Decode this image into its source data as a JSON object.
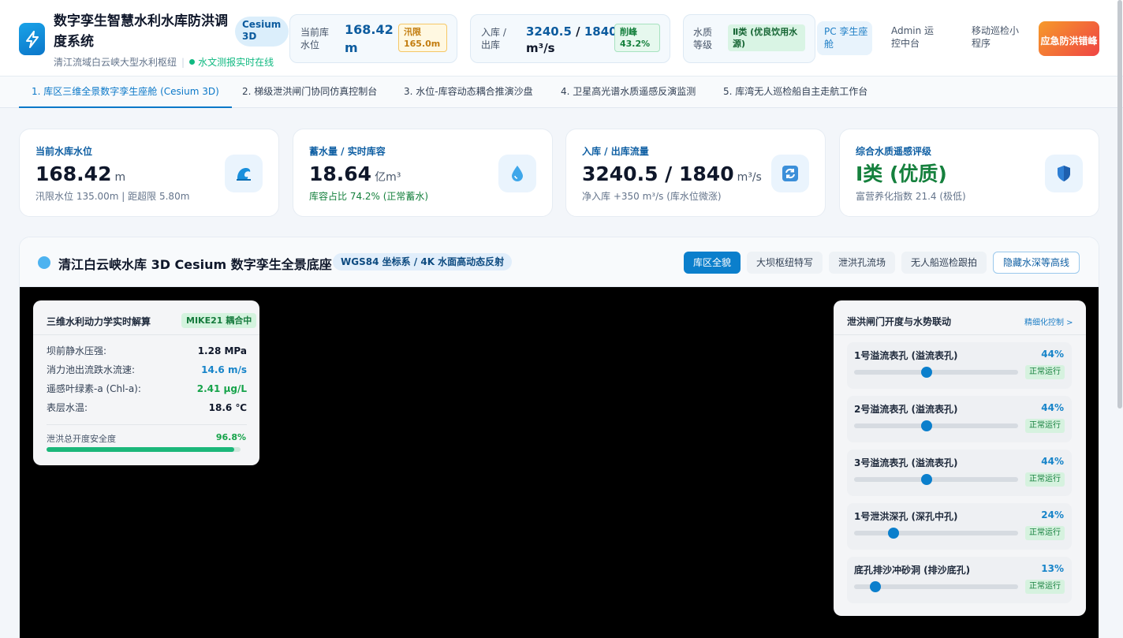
{
  "header": {
    "title": "数字孪生智慧水利水库防洪调度系统",
    "subtitle": "清江流域白云峡大型水利枢纽",
    "sep": "|",
    "live_status": "水文测报实时在线",
    "engine_badge": "Cesium 3D",
    "level": {
      "label": "当前库水位",
      "value": "168.42",
      "unit": "m",
      "badge": "汛限 165.0m"
    },
    "flow": {
      "label": "入库 / 出库",
      "inflow": "3240.5",
      "slash": " / ",
      "outflow": "1840",
      "unit": "m³/s",
      "badge": "削峰 43.2%"
    },
    "quality": {
      "label": "水质等级",
      "badge": "Ⅱ类 (优良饮用水源)"
    },
    "links": [
      "PC 孪生座舱",
      "Admin 运控中台",
      "移动巡检小程序"
    ],
    "emergency": "应急防洪错峰"
  },
  "tabs": [
    "1. 库区三维全景数字孪生座舱 (Cesium 3D)",
    "2. 梯级泄洪闸门协同仿真控制台",
    "3. 水位-库容动态耦合推演沙盘",
    "4. 卫星高光谱水质遥感反演监测",
    "5. 库湾无人巡检船自主走航工作台"
  ],
  "kpis": [
    {
      "label": "当前水库水位",
      "value": "168.42",
      "unit": "m",
      "sub": "汛限水位 135.00m | 距超限 5.80m",
      "icon": "wave-icon"
    },
    {
      "label": "蓄水量 / 实时库容",
      "value": "18.64",
      "unit": "亿m³",
      "sub": "库容占比 74.2% (正常蓄水)",
      "icon": "droplet-icon"
    },
    {
      "label": "入库 / 出库流量",
      "value": "3240.5 / 1840",
      "unit": "m³/s",
      "sub": "净入库 +350 m³/s (库水位微涨)",
      "icon": "refresh-icon"
    },
    {
      "label": "综合水质遥感评级",
      "value": "Ⅰ类 (优质)",
      "unit": "",
      "sub": "富营养化指数 21.4 (极低)",
      "icon": "shield-icon"
    }
  ],
  "panel": {
    "title": "清江白云峡水库 3D Cesium 数字孪生全景底座",
    "tag": "WGS84 坐标系 / 4K 水面高动态反射",
    "views": [
      "库区全貌",
      "大坝枢纽特写",
      "泄洪孔流场",
      "无人船巡检跟拍"
    ],
    "toggle": "隐藏水深等高线"
  },
  "hydro": {
    "title": "三维水利动力学实时解算",
    "badge": "MIKE21 耦合中",
    "rows": [
      {
        "k": "坝前静水压强:",
        "v": "1.28 MPa"
      },
      {
        "k": "消力池出流跌水流速:",
        "v": "14.6 m/s"
      },
      {
        "k": "遥感叶绿素-a (Chl-a):",
        "v": "2.41 μg/L"
      },
      {
        "k": "表层水温:",
        "v": "18.6 ℃"
      }
    ],
    "safety_label": "泄洪总开度安全度",
    "safety_value": "96.8%",
    "safety_fraction": 0.968
  },
  "gates": {
    "title": "泄洪闸门开度与水势联动",
    "link": "精细化控制 >",
    "items": [
      {
        "name": "1号溢流表孔 (溢流表孔)",
        "pct": "44%",
        "fraction": 0.44,
        "status": "正常运行"
      },
      {
        "name": "2号溢流表孔 (溢流表孔)",
        "pct": "44%",
        "fraction": 0.44,
        "status": "正常运行"
      },
      {
        "name": "3号溢流表孔 (溢流表孔)",
        "pct": "44%",
        "fraction": 0.44,
        "status": "正常运行"
      },
      {
        "name": "1号泄洪深孔 (深孔中孔)",
        "pct": "24%",
        "fraction": 0.24,
        "status": "正常运行"
      },
      {
        "name": "底孔排沙冲砂洞 (排沙底孔)",
        "pct": "13%",
        "fraction": 0.13,
        "status": "正常运行"
      }
    ]
  },
  "colors": {
    "accent": "#0b7fcc",
    "success": "#16a34a",
    "warn": "#c27c0e",
    "danger": "#ef4444"
  }
}
